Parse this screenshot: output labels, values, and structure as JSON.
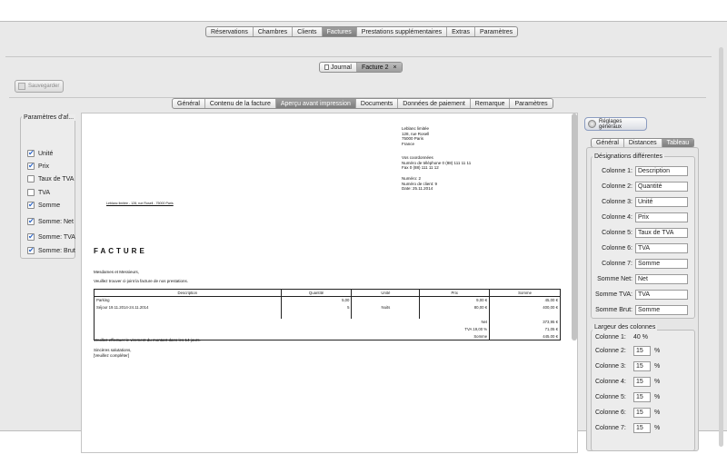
{
  "main_tabs": [
    "Réservations",
    "Chambres",
    "Clients",
    "Factures",
    "Prestations supplémentaires",
    "Extras",
    "Paramètres"
  ],
  "main_active": "Factures",
  "doc_tabs": {
    "journal": "Journal",
    "current": "Facture 2",
    "close": "×"
  },
  "save_label": "Sauvegarder",
  "sub_tabs": [
    "Général",
    "Contenu de la facture",
    "Aperçu avant impression",
    "Documents",
    "Données de paiement",
    "Remarque",
    "Paramètres"
  ],
  "sub_active": "Aperçu avant impression",
  "display_options": {
    "title": "Paramètres d'af...",
    "items": [
      {
        "label": "Unité",
        "checked": true
      },
      {
        "label": "Prix",
        "checked": true
      },
      {
        "label": "Taux de TVA",
        "checked": false
      },
      {
        "label": "TVA",
        "checked": false
      },
      {
        "label": "Somme",
        "checked": true
      },
      {
        "label": "Somme: Net",
        "checked": true
      },
      {
        "label": "Somme: TVA",
        "checked": true
      },
      {
        "label": "Somme: Brut",
        "checked": true
      }
    ]
  },
  "preview": {
    "sender_line": "Leblanc limitée - 128, rue Rosell - 75000 Paris",
    "company": [
      "Leblanc limitée",
      "128, rue Rosell",
      "75000 Paris",
      "France"
    ],
    "contact": [
      "Vos coordonnées",
      "Numéro de téléphone 0 (88) 111 11 11",
      "Fax 0 (88) 111 11 12"
    ],
    "refs": [
      "Numéro: 2",
      "Numéro de client: 9",
      "Date: 25.11.2014"
    ],
    "heading": "FACTURE",
    "greeting": "Mesdames et Messieurs,",
    "intro": "Veuillez trouver ci-joint la facture de nos prestations.",
    "columns": [
      "Description",
      "Quantité",
      "Unité",
      "Prix",
      "Somme"
    ],
    "rows": [
      [
        "Parking",
        "5,00",
        "",
        "9,00 €",
        "45,00 €"
      ],
      [
        "Séjour 19.11.2014-24.11.2014",
        "5",
        "Nuits",
        "80,00 €",
        "400,00 €"
      ]
    ],
    "totals": [
      {
        "label": "Net",
        "value": "373,95 €"
      },
      {
        "label": "TVA 19,00 %",
        "value": "71,05 €"
      },
      {
        "label": "Somme",
        "value": "445,00 €"
      }
    ],
    "payment": "Veuillez effectuer le virement du montant dans les 14 jours.",
    "closing": "Sincères salutations,",
    "placeholder": "[Veuillez compléter]"
  },
  "right": {
    "reglages_label": "Réglages généraux",
    "tabs": [
      "Général",
      "Distances",
      "Tableau"
    ],
    "active_tab": "Tableau",
    "designations_title": "Désignations différentes",
    "designations": [
      {
        "label": "Colonne 1:",
        "value": "Description"
      },
      {
        "label": "Colonne 2:",
        "value": "Quantité"
      },
      {
        "label": "Colonne 3:",
        "value": "Unité"
      },
      {
        "label": "Colonne 4:",
        "value": "Prix"
      },
      {
        "label": "Colonne 5:",
        "value": "Taux de TVA"
      },
      {
        "label": "Colonne 6:",
        "value": "TVA"
      },
      {
        "label": "Colonne 7:",
        "value": "Somme"
      },
      {
        "label": "Somme Net:",
        "value": "Net"
      },
      {
        "label": "Somme TVA:",
        "value": "TVA"
      },
      {
        "label": "Somme Brut:",
        "value": "Somme"
      }
    ],
    "widths_title": "Largeur des colonnes",
    "col1_label": "Colonne 1:",
    "col1_value": "40 %",
    "widths": [
      {
        "label": "Colonne 2:",
        "value": "15",
        "unit": "%"
      },
      {
        "label": "Colonne 3:",
        "value": "15",
        "unit": "%"
      },
      {
        "label": "Colonne 4:",
        "value": "15",
        "unit": "%"
      },
      {
        "label": "Colonne 5:",
        "value": "15",
        "unit": "%"
      },
      {
        "label": "Colonne 6:",
        "value": "15",
        "unit": "%"
      },
      {
        "label": "Colonne 7:",
        "value": "15",
        "unit": "%"
      }
    ]
  }
}
